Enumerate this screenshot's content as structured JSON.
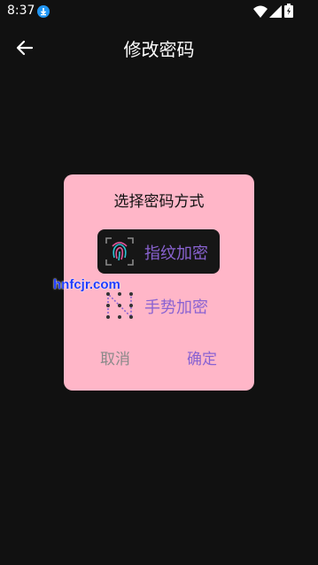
{
  "status": {
    "time": "8:37"
  },
  "header": {
    "title": "修改密码",
    "back_icon": "arrow-left-icon"
  },
  "dialog": {
    "title": "选择密码方式",
    "options": [
      {
        "label": "指纹加密",
        "icon": "fingerprint-icon",
        "selected": true
      },
      {
        "label": "手势加密",
        "icon": "gesture-pattern-icon",
        "selected": false
      }
    ],
    "cancel_label": "取消",
    "confirm_label": "确定"
  },
  "watermark": {
    "text": "hnfcjr.com"
  },
  "colors": {
    "background": "#111111",
    "dialog_bg": "#FFB6C8",
    "accent": "#8A63D2",
    "cancel": "#8a8a8a"
  }
}
